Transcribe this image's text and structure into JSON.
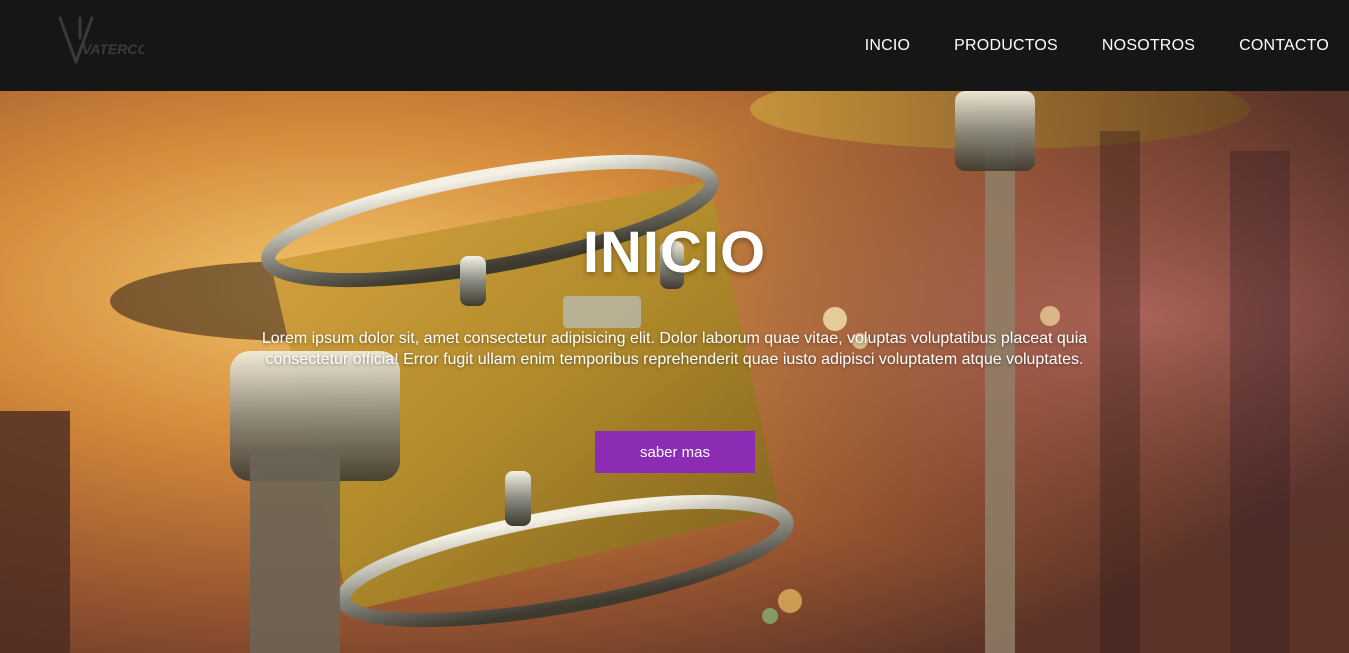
{
  "brand": {
    "logo_text": "VATERCOR"
  },
  "nav": {
    "items": [
      {
        "label": "INCIO"
      },
      {
        "label": "PRODUCTOS"
      },
      {
        "label": "NOSOTROS"
      },
      {
        "label": "CONTACTO"
      }
    ]
  },
  "hero": {
    "title": "INICIO",
    "text": "Lorem ipsum dolor sit, amet consectetur adipisicing elit. Dolor laborum quae vitae, voluptas voluptatibus placeat quia consectetur officia! Error fugit ullam enim temporibus reprehenderit quae iusto adipisci voluptatem atque voluptates.",
    "button_label": "saber mas",
    "background_image": "drum-kit-photo"
  },
  "colors": {
    "navbar": "#161616",
    "button": "#8c2bb3",
    "text": "#ffffff"
  }
}
